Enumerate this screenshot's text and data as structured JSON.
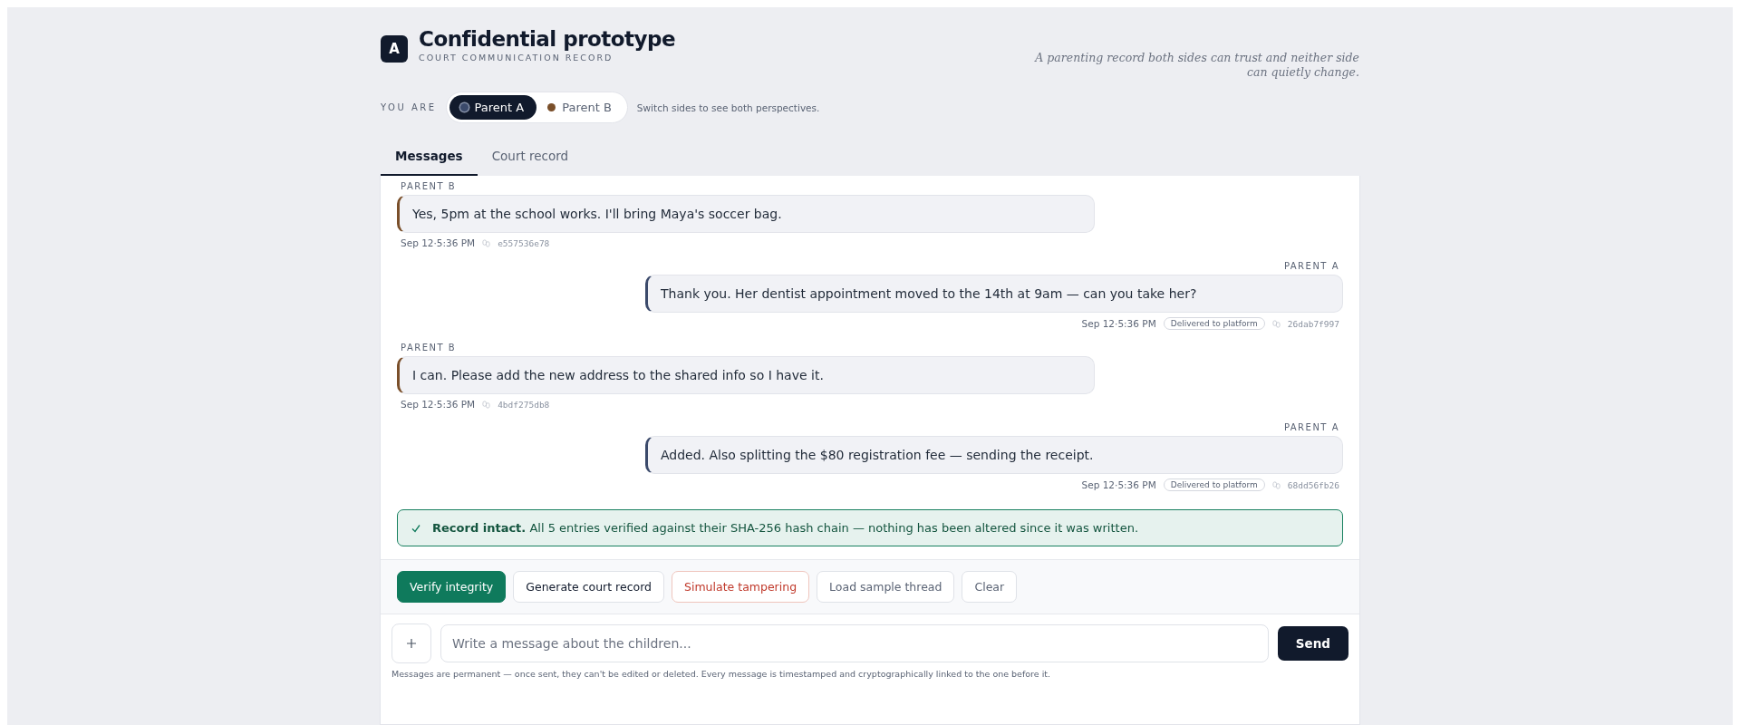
{
  "header": {
    "logo": "A",
    "title": "Confidential prototype",
    "subtitle": "COURT COMMUNICATION RECORD",
    "tagline": "A parenting record both sides can trust and neither side can quietly change."
  },
  "perspective": {
    "label": "YOU ARE",
    "options": [
      {
        "label": "Parent A",
        "selected": true,
        "color": "#3b4a6b"
      },
      {
        "label": "Parent B",
        "selected": false,
        "color": "#7a4f2a"
      }
    ],
    "hint": "Switch sides to see both perspectives."
  },
  "tabs": [
    {
      "label": "Messages",
      "selected": true
    },
    {
      "label": "Court record",
      "selected": false
    }
  ],
  "messages": [
    {
      "sender": "PARENT B",
      "mine": false,
      "text": "Yes, 5pm at the school works. I'll bring Maya's soccer bag.",
      "time": "Sep 12·5:36 PM",
      "hash": "e557536e78"
    },
    {
      "sender": "PARENT A",
      "mine": true,
      "text": "Thank you. Her dentist appointment moved to the 14th at 9am — can you take her?",
      "time": "Sep 12·5:36 PM",
      "status": "Delivered to platform",
      "hash": "26dab7f997"
    },
    {
      "sender": "PARENT B",
      "mine": false,
      "text": "I can. Please add the new address to the shared info so I have it.",
      "time": "Sep 12·5:36 PM",
      "hash": "4bdf275db8"
    },
    {
      "sender": "PARENT A",
      "mine": true,
      "text": "Added. Also splitting the $80 registration fee — sending the receipt.",
      "time": "Sep 12·5:36 PM",
      "status": "Delivered to platform",
      "hash": "68dd56fb26"
    }
  ],
  "banner": {
    "text": "**Record intact.** All 5 entries verified against their SHA-256 hash chain — nothing has been altered since it was written."
  },
  "actions": [
    {
      "label": "Verify integrity",
      "kind": "primary"
    },
    {
      "label": "Generate court record",
      "kind": "default"
    },
    {
      "label": "Simulate tampering",
      "kind": "danger"
    },
    {
      "label": "Load sample thread",
      "kind": "muted"
    },
    {
      "label": "Clear",
      "kind": "muted"
    }
  ],
  "composer": {
    "placeholder": "Write a message about the children...",
    "send": "Send"
  },
  "footnote": "Messages are permanent — once sent, they can't be edited or deleted. Every message is timestamped and cryptographically linked to the one before it."
}
